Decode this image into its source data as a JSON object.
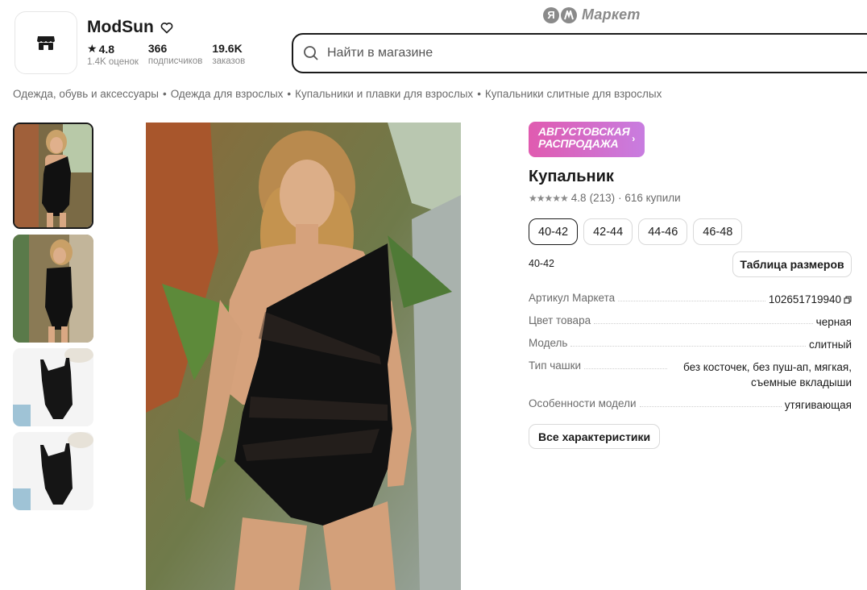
{
  "brand": {
    "market_badge": "Я",
    "market_name": "Маркет"
  },
  "shop": {
    "name": "ModSun",
    "rating": "4.8",
    "rating_label": "1.4K оценок",
    "subscribers": "366",
    "subscribers_label": "подписчиков",
    "orders": "19.6K",
    "orders_label": "заказов",
    "icons": [
      "shop-awning-icon",
      "heart-icon",
      "star-icon"
    ]
  },
  "search": {
    "placeholder": "Найти в магазине",
    "icon": "search-icon"
  },
  "breadcrumbs": [
    "Одежда, обувь и аксессуары",
    "Одежда для взрослых",
    "Купальники и плавки для взрослых",
    "Купальники слитные для взрослых"
  ],
  "breadcrumb_separator": "•",
  "promo": {
    "line1": "АВГУСТОВСКАЯ",
    "line2": "РАСПРОДАЖА",
    "chevron": "›"
  },
  "product": {
    "title": "Купальник",
    "stars": "★★★★★",
    "rating": "4.8",
    "reviews": "(213)",
    "bought": "· 616 купили",
    "sizes": [
      "40-42",
      "42-44",
      "44-46",
      "46-48"
    ],
    "selected_size": "40-42",
    "size_table_label": "Таблица размеров",
    "specs": [
      {
        "key": "Артикул Маркета",
        "value": "102651719940"
      },
      {
        "key": "Цвет товара",
        "value": "черная"
      },
      {
        "key": "Модель",
        "value": "слитный"
      },
      {
        "key": "Тип чашки",
        "value": "без косточек, без пуш-ап, мягкая, съемные вкладыши"
      },
      {
        "key": "Особенности модели",
        "value": "утягивающая"
      }
    ],
    "all_specs_label": "Все характеристики"
  },
  "colors": {
    "text": "#1a1a1a",
    "muted": "#6b6b6b",
    "promo_start": "#e05bb0",
    "promo_end": "#c87de0",
    "swimsuit": "#111111"
  }
}
